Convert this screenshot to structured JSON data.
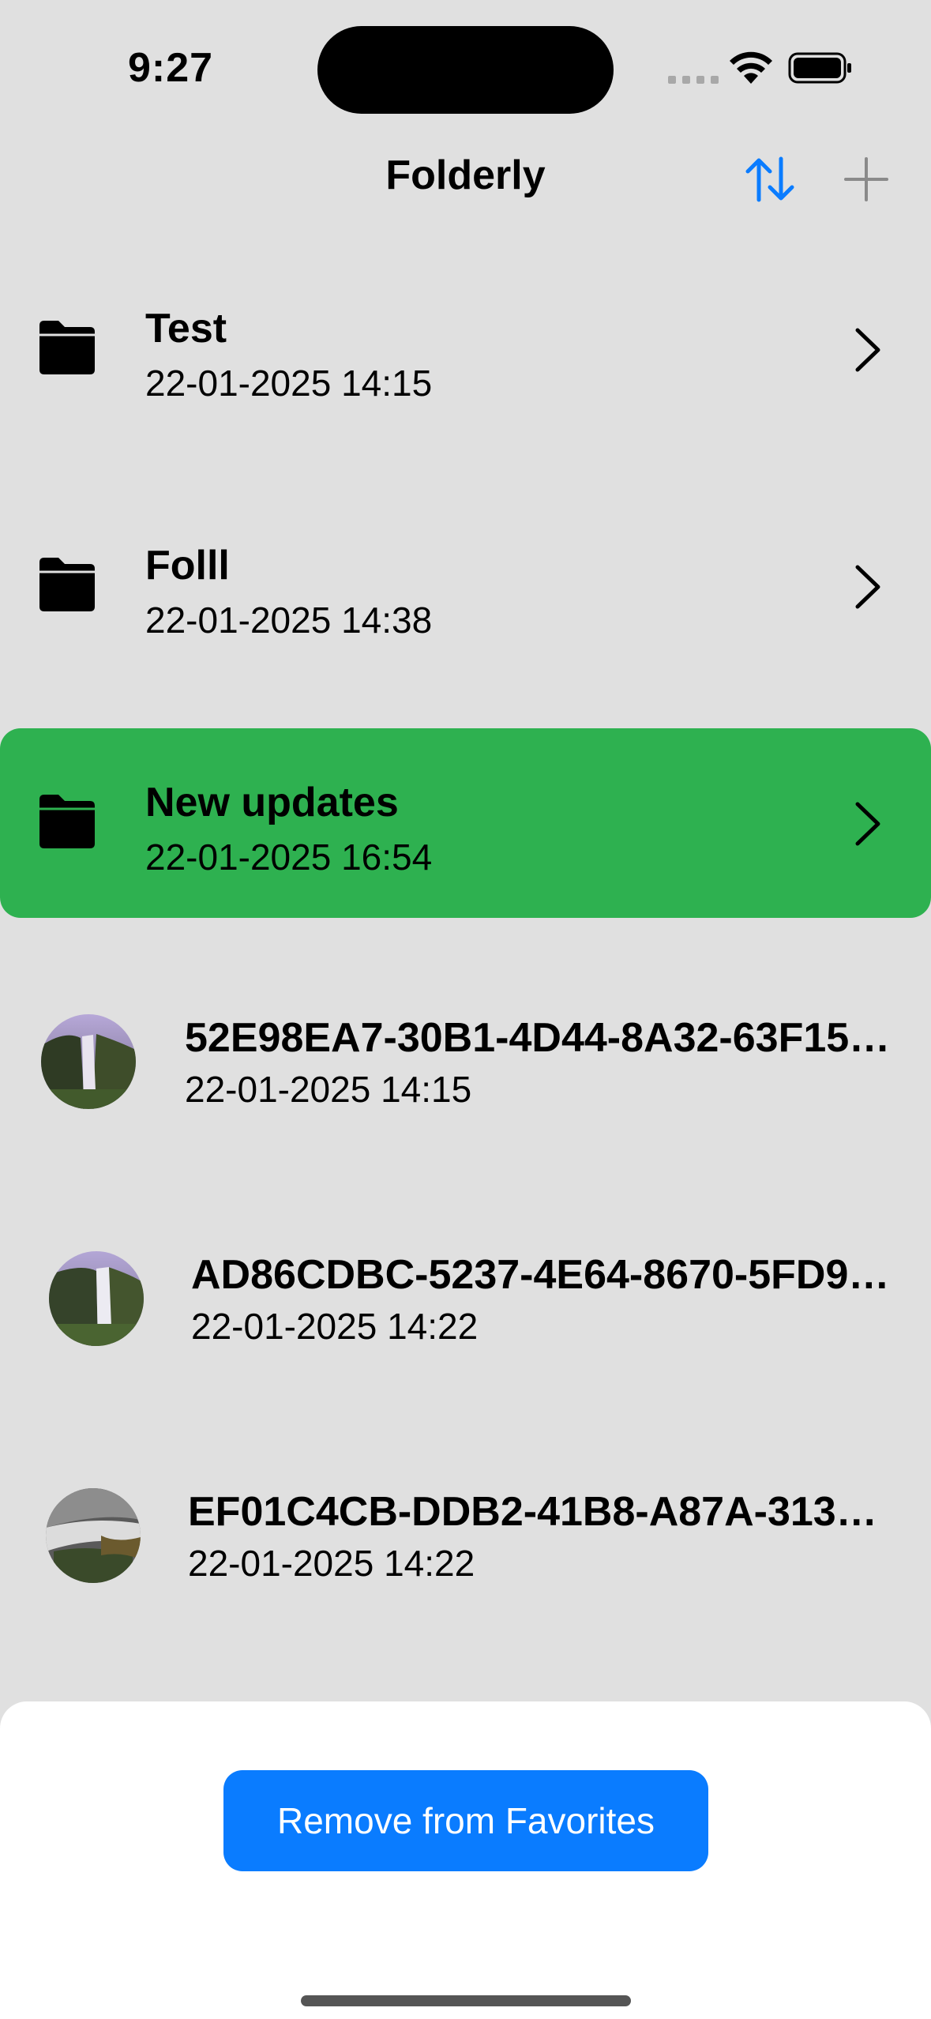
{
  "status_bar": {
    "time": "9:27"
  },
  "nav": {
    "title": "Folderly",
    "sort_icon": "sort-arrows-icon",
    "add_icon": "plus-icon",
    "accent": "#0a7cff"
  },
  "folders": [
    {
      "name": "Test",
      "date": "22-01-2025 14:15",
      "highlighted": false
    },
    {
      "name": "Folll",
      "date": "22-01-2025 14:38",
      "highlighted": false
    },
    {
      "name": "New updates",
      "date": "22-01-2025 16:54",
      "highlighted": true
    }
  ],
  "images": [
    {
      "name": "52E98EA7-30B1-4D44-8A32-63F15…",
      "date": "22-01-2025 14:15"
    },
    {
      "name": "AD86CDBC-5237-4E64-8670-5FD9…",
      "date": "22-01-2025 14:22"
    },
    {
      "name": "EF01C4CB-DDB2-41B8-A87A-313F…",
      "date": "22-01-2025 14:22"
    }
  ],
  "sheet": {
    "remove_button_label": "Remove from Favorites"
  },
  "colors": {
    "background": "#e0e0e0",
    "highlight": "#2eb150",
    "button": "#0a7cff"
  }
}
